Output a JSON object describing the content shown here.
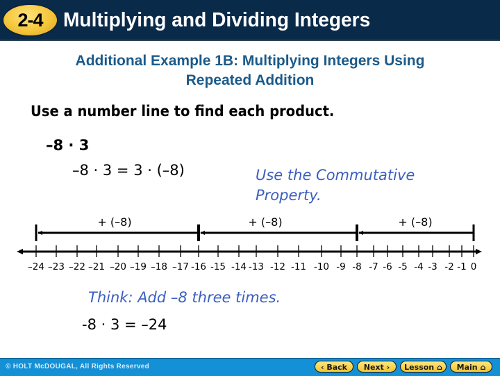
{
  "header": {
    "lesson_number": "2-4",
    "title": "Multiplying and Dividing Integers"
  },
  "subtitle": {
    "line1": "Additional Example 1B: Multiplying Integers Using",
    "line2": "Repeated Addition"
  },
  "instruction": "Use a number line to find each product.",
  "problem": "–8 · 3",
  "equation1": "–8 · 3 = 3 · (–8)",
  "note": {
    "line1": "Use the Commutative",
    "line2": "Property."
  },
  "number_line": {
    "min": -24,
    "max": 0,
    "tick_labels": [
      "–24",
      "–23",
      "–22",
      "–21",
      "–20",
      "–19",
      "–18",
      "–17",
      "-16",
      "-15",
      "-14",
      "-13",
      "-12",
      "-11",
      "-10",
      "-9",
      "-8",
      "-7",
      "-6",
      "-5",
      "-4",
      "-3",
      "-2",
      "-1",
      "0"
    ],
    "segments": [
      {
        "label": "+ (–8)",
        "from": -16,
        "to": -24
      },
      {
        "label": "+ (–8)",
        "from": -8,
        "to": -16
      },
      {
        "label": "+ (–8)",
        "from": 0,
        "to": -8
      }
    ]
  },
  "think": "Think: Add –8 three times.",
  "equation2": "-8 · 3 = –24",
  "footer": {
    "copyright": "© HOLT McDOUGAL, All Rights Reserved",
    "buttons": {
      "back": "‹ Back",
      "next": "Next ›",
      "lesson": "Lesson ⌂",
      "main": "Main ⌂"
    }
  }
}
